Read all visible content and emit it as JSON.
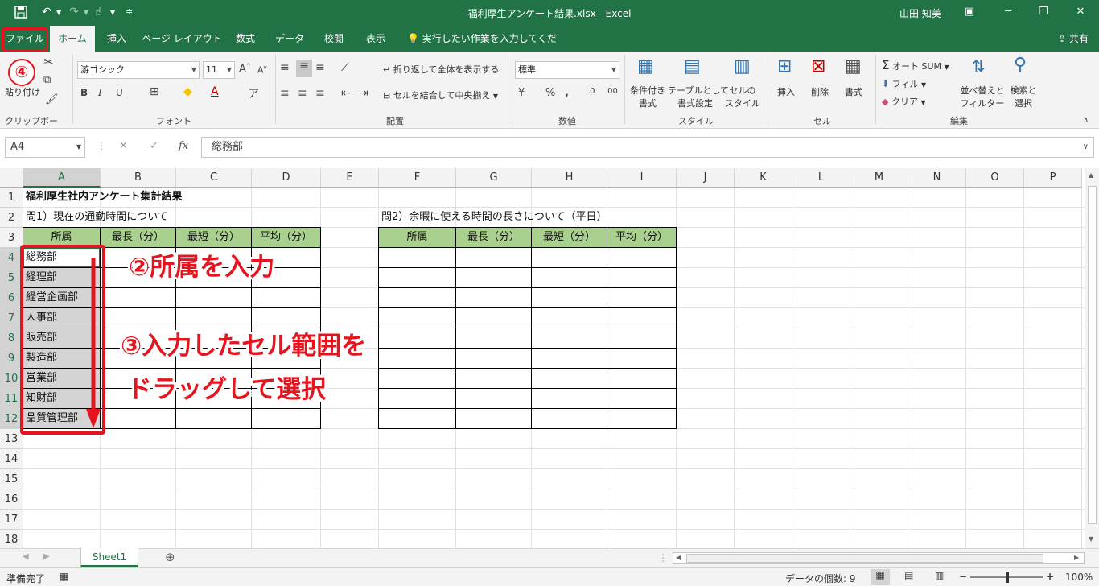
{
  "window": {
    "title": "福利厚生アンケート結果.xlsx  -  Excel",
    "user": "山田 知美",
    "share": "共有"
  },
  "tabs": [
    {
      "id": "file",
      "label": "ファイル"
    },
    {
      "id": "home",
      "label": "ホーム"
    },
    {
      "id": "insert",
      "label": "挿入"
    },
    {
      "id": "layout",
      "label": "ページ レイアウト"
    },
    {
      "id": "formulas",
      "label": "数式"
    },
    {
      "id": "data",
      "label": "データ"
    },
    {
      "id": "review",
      "label": "校閲"
    },
    {
      "id": "view",
      "label": "表示"
    }
  ],
  "tellme": "実行したい作業を入力してください",
  "ribbon": {
    "paste": "貼り付け",
    "clipboard": "クリップボード",
    "font_name": "游ゴシック",
    "font_size": "11",
    "font_group": "フォント",
    "wrap": "折り返して全体を表示する",
    "merge": "セルを結合して中央揃え",
    "align_group": "配置",
    "number_format": "標準",
    "number_group": "数値",
    "cond_format_1": "条件付き",
    "cond_format_2": "書式",
    "table_format_1": "テーブルとして",
    "table_format_2": "書式設定",
    "cell_style_1": "セルの",
    "cell_style_2": "スタイル",
    "style_group": "スタイル",
    "insert": "挿入",
    "delete": "削除",
    "format": "書式",
    "cells_group": "セル",
    "autosum": "オート SUM",
    "fill": "フィル",
    "clear": "クリア",
    "sort_1": "並べ替えと",
    "sort_2": "フィルター",
    "find_1": "検索と",
    "find_2": "選択",
    "edit_group": "編集"
  },
  "formula_bar": {
    "name_box": "A4",
    "formula": "総務部"
  },
  "columns": [
    "A",
    "B",
    "C",
    "D",
    "E",
    "F",
    "G",
    "H",
    "I",
    "J",
    "K",
    "L",
    "M",
    "N",
    "O",
    "P"
  ],
  "rows": [
    "1",
    "2",
    "3",
    "4",
    "5",
    "6",
    "7",
    "8",
    "9",
    "10",
    "11",
    "12",
    "13",
    "14",
    "15",
    "16",
    "17",
    "18"
  ],
  "sheet": {
    "title": "福利厚生社内アンケート集計結果",
    "q1": "問1）現在の通勤時間について",
    "q2": "問2）余暇に使える時間の長さについて（平日）",
    "headers": [
      "所属",
      "最長（分）",
      "最短（分）",
      "平均（分）"
    ],
    "departments": [
      "総務部",
      "経理部",
      "経営企画部",
      "人事部",
      "販売部",
      "製造部",
      "営業部",
      "知財部",
      "品質管理部"
    ]
  },
  "annotations": {
    "step2": "②所属を入力",
    "step3_line1": "③入力したセル範囲を",
    "step3_line2": "ドラッグして選択",
    "step4": "④"
  },
  "sheet_tab": "Sheet1",
  "status": {
    "ready": "準備完了",
    "count": "データの個数: 9",
    "zoom": "100%"
  },
  "colors": {
    "excel_green": "#217346",
    "header_fill": "#a9d08e",
    "annotation_red": "#e6141e"
  }
}
